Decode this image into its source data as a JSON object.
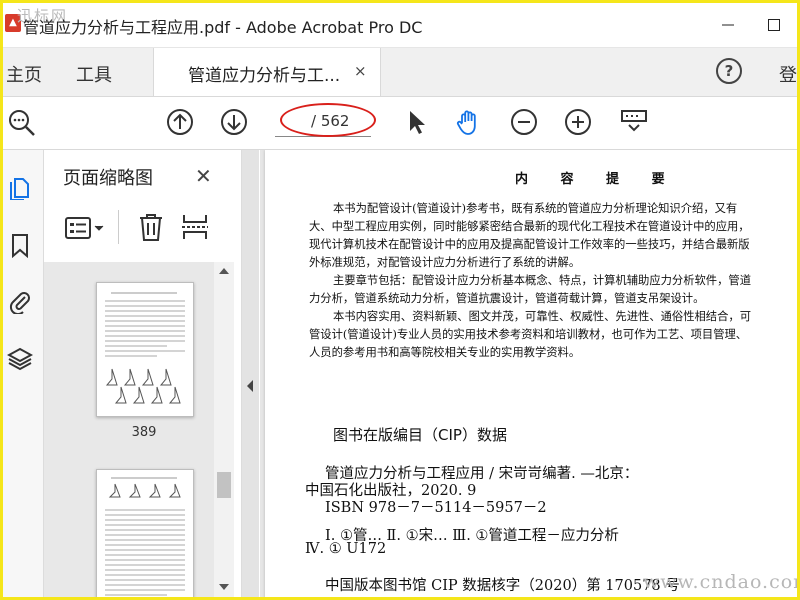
{
  "window": {
    "title": "管道应力分析与工程应用.pdf - Adobe Acrobat Pro DC",
    "app_icon": "pdf-icon",
    "watermark": "迅标网",
    "minimize": "—",
    "maximize": "☐"
  },
  "tabs": {
    "home": "主页",
    "tools": "工具",
    "document": "管道应力分析与工...",
    "close": "×",
    "help": "?",
    "login": "登"
  },
  "toolbar": {
    "page_current": "",
    "page_total": "/ 562"
  },
  "thumbnails_panel": {
    "title": "页面缩略图",
    "close": "✕",
    "pages": [
      {
        "label": "389"
      },
      {
        "label": ""
      }
    ]
  },
  "document": {
    "heading": "内 容 提 要",
    "paragraphs": [
      "本书为配管设计(管道设计)参考书，既有系统的管道应力分析理论知识介绍，又有",
      "大、中型工程应用实例，同时能够紧密结合最新的现代化工程技术在管道设计中的应用，",
      "现代计算机技术在配管设计中的应用及提高配管设计工作效率的一些技巧，并结合最新版",
      "外标准规范，对配管设计应力分析进行了系统的讲解。",
      "主要章节包括：配管设计应力分析基本概念、特点，计算机辅助应力分析软件，管道",
      "力分析，管道系统动力分析，管道抗震设计，管道荷载计算，管道支吊架设计。",
      "本书内容实用、资料新颖、图文并茂，可靠性、权威性、先进性、通俗性相结合，可",
      "管设计(管道设计)专业人员的实用技术参考资料和培训教材，也可作为工艺、项目管理、",
      "人员的参考用书和高等院校相关专业的实用教学资料。"
    ],
    "cip_title": "图书在版编目（CIP）数据",
    "cip_lines": [
      "管道应力分析与工程应用 / 宋岢岢编著. —北京：",
      "中国石化出版社，2020. 9",
      "ISBN 978－7－5114－5957－2",
      "Ⅰ. ①管…  Ⅱ. ①宋…  Ⅲ. ①管道工程－应力分析",
      "Ⅳ. ① U172",
      "中国版本图书馆 CIP 数据核字（2020）第 170578 号"
    ],
    "watermark": "www.cndao.com"
  },
  "colors": {
    "border": "#f5e61a",
    "oval": "#d9201b",
    "accent": "#1473e6"
  }
}
